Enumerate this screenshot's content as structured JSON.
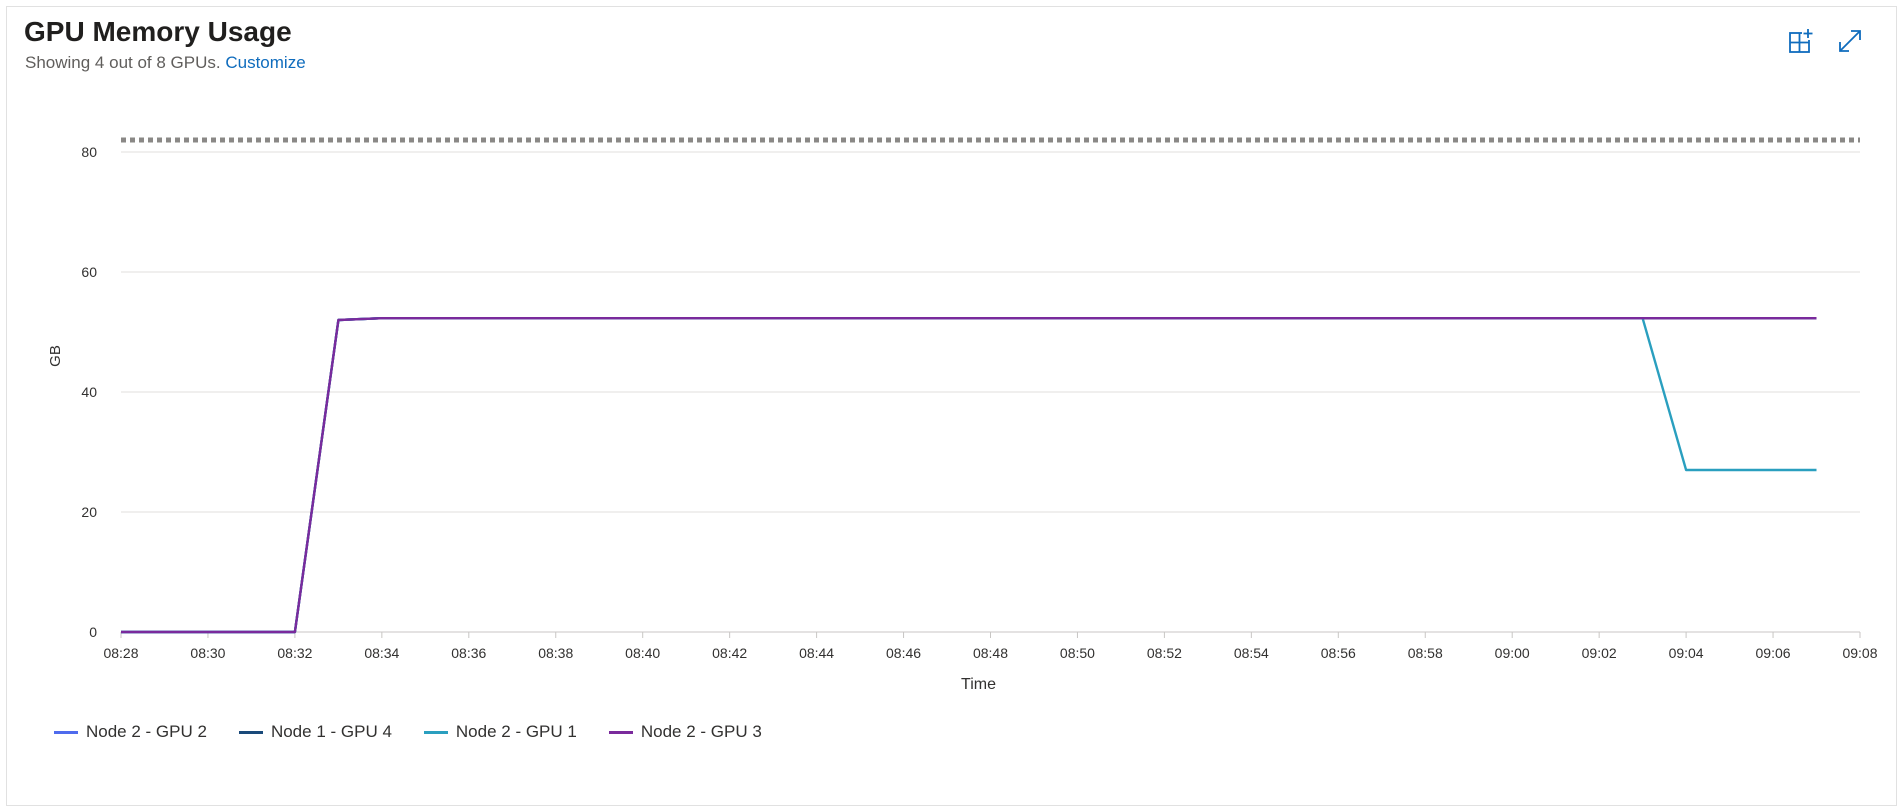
{
  "header": {
    "title": "GPU Memory Usage",
    "subtitle_prefix": "Showing 4 out of 8 GPUs.",
    "customize_link": "Customize"
  },
  "toolbar": {
    "pin_icon": "add-to-dashboard-icon",
    "expand_icon": "expand-icon"
  },
  "colors": {
    "node2_gpu2": "#4f6bed",
    "node1_gpu4": "#1a4a7a",
    "node2_gpu1": "#2a9fbf",
    "node2_gpu3": "#7a2a9c",
    "threshold": "#8a8886",
    "grid": "#e1dfdd",
    "axis_text": "#323130"
  },
  "chart_data": {
    "type": "line",
    "title": "GPU Memory Usage",
    "xlabel": "Time",
    "ylabel": "GB",
    "x_ticks": [
      "08:28",
      "08:30",
      "08:32",
      "08:34",
      "08:36",
      "08:38",
      "08:40",
      "08:42",
      "08:44",
      "08:46",
      "08:48",
      "08:50",
      "08:52",
      "08:54",
      "08:56",
      "08:58",
      "09:00",
      "09:02",
      "09:04",
      "09:06",
      "09:08"
    ],
    "y_ticks": [
      0,
      20,
      40,
      60,
      80
    ],
    "ylim": [
      0,
      82
    ],
    "xlim": [
      "08:28",
      "09:08"
    ],
    "threshold": 82,
    "grid": true,
    "legend_position": "bottom-left",
    "series": [
      {
        "name": "Node 2 - GPU 2",
        "x": [
          "08:28",
          "08:32",
          "08:33",
          "08:34",
          "09:03",
          "09:07"
        ],
        "values": [
          0,
          0,
          52,
          52.3,
          52.3,
          52.3
        ]
      },
      {
        "name": "Node 1 - GPU 4",
        "x": [
          "08:28",
          "08:32",
          "08:33",
          "08:34",
          "09:03",
          "09:07"
        ],
        "values": [
          0,
          0,
          52,
          52.3,
          52.3,
          52.3
        ]
      },
      {
        "name": "Node 2 - GPU 1",
        "x": [
          "08:28",
          "08:32",
          "08:33",
          "08:34",
          "09:03",
          "09:04",
          "09:07"
        ],
        "values": [
          0,
          0,
          52,
          52.3,
          52.3,
          27,
          27
        ]
      },
      {
        "name": "Node 2 - GPU 3",
        "x": [
          "08:28",
          "08:32",
          "08:33",
          "08:34",
          "09:03",
          "09:07"
        ],
        "values": [
          0,
          0,
          52,
          52.3,
          52.3,
          52.3
        ]
      }
    ]
  },
  "legend": [
    {
      "label": "Node 2 - GPU 2",
      "color": "#4f6bed"
    },
    {
      "label": "Node 1 - GPU 4",
      "color": "#1a4a7a"
    },
    {
      "label": "Node 2 - GPU 1",
      "color": "#2a9fbf"
    },
    {
      "label": "Node 2 - GPU 3",
      "color": "#7a2a9c"
    }
  ]
}
